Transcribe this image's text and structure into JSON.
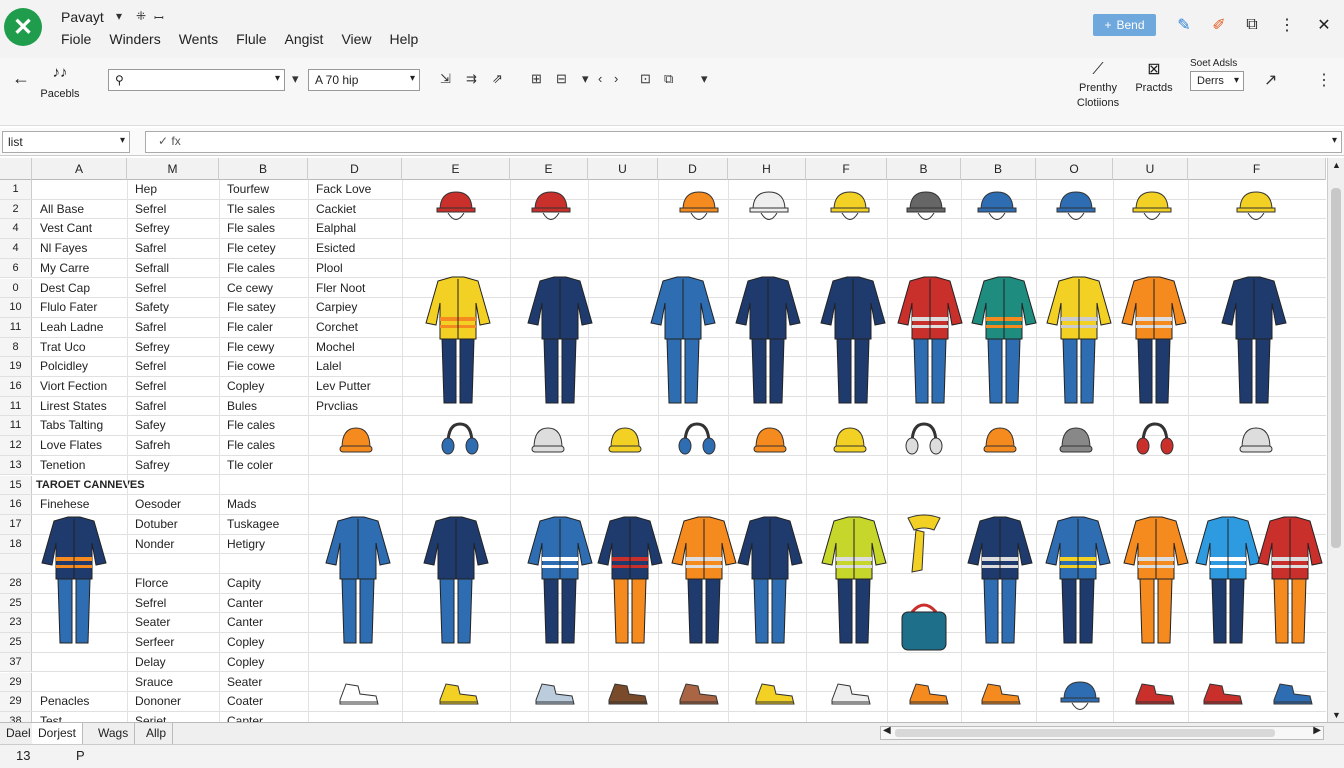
{
  "app": {
    "title": "Pavayt",
    "logo": "✕"
  },
  "title_icons": [
    "▾",
    "⁜",
    "ꟷ"
  ],
  "menu": [
    "Fiole",
    "Winders",
    "Wents",
    "Flule",
    "Angist",
    "View",
    "Help"
  ],
  "topright": {
    "send_label": "Bend",
    "send_icon": "+",
    "icons": [
      {
        "name": "pin-icon",
        "glyph": "✎",
        "color": "#2a7fd4"
      },
      {
        "name": "brush-icon",
        "glyph": "✐",
        "color": "#e2571b"
      },
      {
        "name": "copy-icon",
        "glyph": "⧉",
        "color": "#333"
      },
      {
        "name": "more-icon",
        "glyph": "⋮",
        "color": "#333"
      }
    ],
    "close": "✕"
  },
  "ribbon": {
    "paste_label": "Pacebls",
    "paste_icon": "♪♪",
    "search_value": "",
    "font_value": "A  70 hip",
    "tools_left": [
      "⇲",
      "⇉",
      "⇗"
    ],
    "tools_mid": [
      "⊞",
      "⊟",
      "▾",
      "‹",
      "›"
    ],
    "tools_right": [
      "⊡",
      "⧉",
      "▾"
    ],
    "big": [
      {
        "name": "prenthy",
        "label": "Prenthy Clotiions",
        "icon": "⟋"
      },
      {
        "name": "practds",
        "label": "Practds",
        "icon": "⊠"
      }
    ],
    "sort_label": "Soet Adsls",
    "sort_value": "Derrs",
    "chart_icon": "↗",
    "more": "⋮"
  },
  "formula": {
    "name_box": "list",
    "icons": "✓  fx",
    "value": ""
  },
  "columns": [
    "A",
    "M",
    "B",
    "D",
    "E",
    "E",
    "U",
    "D",
    "H",
    "F",
    "B",
    "B",
    "O",
    "U",
    "F"
  ],
  "rows": [
    {
      "n": "1",
      "a": "",
      "b": "Hep",
      "c": "Tourfew",
      "d": "Fack Love"
    },
    {
      "n": "2",
      "a": "All Base",
      "b": "Sefrel",
      "c": "Tle sales",
      "d": "Cackiet"
    },
    {
      "n": "4",
      "a": "Vest Cant",
      "b": "Sefrey",
      "c": "Fle sales",
      "d": "Ealphal"
    },
    {
      "n": "4",
      "a": "Nl Fayes",
      "b": "Safrel",
      "c": "Fle cetey",
      "d": "Esicted"
    },
    {
      "n": "6",
      "a": "My Carre",
      "b": "Sefrall",
      "c": "Fle cales",
      "d": "Plool"
    },
    {
      "n": "0",
      "a": "Dest Cap",
      "b": "Sefrel",
      "c": "Ce cewy",
      "d": "Fler Noot"
    },
    {
      "n": "10",
      "a": "Flulo Fater",
      "b": "Safety",
      "c": "Fle satey",
      "d": "Carpiey"
    },
    {
      "n": "11",
      "a": "Leah Ladne",
      "b": "Safrel",
      "c": "Fle caler",
      "d": "Corchet"
    },
    {
      "n": "8",
      "a": "Trat Uco",
      "b": "Sefrey",
      "c": "Fle cewy",
      "d": "Mochel"
    },
    {
      "n": "19",
      "a": "Polcidley",
      "b": "Sefrel",
      "c": "Fie cowe",
      "d": "Lalel"
    },
    {
      "n": "16",
      "a": "Viort Fection",
      "b": "Sefrel",
      "c": "Copley",
      "d": "Lev Putter"
    },
    {
      "n": "11",
      "a": "Lirest States",
      "b": "Safrel",
      "c": "Bules",
      "d": "Prvclias"
    },
    {
      "n": "11",
      "a": "Tabs Talting",
      "b": "Safey",
      "c": "Fle cales",
      "d": ""
    },
    {
      "n": "12",
      "a": "Love Flates",
      "b": "Safreh",
      "c": "Fle cales",
      "d": ""
    },
    {
      "n": "13",
      "a": "Tenetion",
      "b": "Safrey",
      "c": "Tle coler",
      "d": ""
    },
    {
      "n": "15",
      "a": "TAROET CANNEVES",
      "b": "",
      "c": "",
      "d": "",
      "section": true
    },
    {
      "n": "16",
      "a": "Finehese",
      "b": "Oesoder",
      "c": "Mads",
      "d": ""
    },
    {
      "n": "17",
      "a": "",
      "b": "Dotuber",
      "c": "Tuskagee",
      "d": ""
    },
    {
      "n": "18",
      "a": "",
      "b": "Nonder",
      "c": "Hetigry",
      "d": ""
    },
    {
      "n": "",
      "a": "",
      "b": "",
      "c": "",
      "d": ""
    },
    {
      "n": "28",
      "a": "",
      "b": "Florce",
      "c": "Capity",
      "d": ""
    },
    {
      "n": "25",
      "a": "",
      "b": "Sefrel",
      "c": "Canter",
      "d": ""
    },
    {
      "n": "23",
      "a": "",
      "b": "Seater",
      "c": "Canter",
      "d": ""
    },
    {
      "n": "25",
      "a": "",
      "b": "Serfeer",
      "c": "Copley",
      "d": ""
    },
    {
      "n": "37",
      "a": "",
      "b": "Delay",
      "c": "Copley",
      "d": ""
    },
    {
      "n": "29",
      "a": "",
      "b": "Srauce",
      "c": "Seater",
      "d": ""
    },
    {
      "n": "29",
      "a": "Penacles",
      "b": "Dononer",
      "c": "Coater",
      "d": ""
    },
    {
      "n": "38",
      "a": "Test",
      "b": "Seriet",
      "c": "Capter",
      "d": ""
    }
  ],
  "sheet_tabs": [
    "Dael",
    "Dorjest",
    "Wags",
    "Allp"
  ],
  "status": {
    "count": "13",
    "mode": "P"
  },
  "colors": {
    "excel_green": "#1f9d4c",
    "send_blue": "#6fa8dc",
    "navy": "#1f3b6e",
    "hivis_yellow": "#f2d024",
    "hivis_orange": "#f58a1f",
    "workwear_blue": "#2f6db3",
    "red": "#c9302c"
  }
}
